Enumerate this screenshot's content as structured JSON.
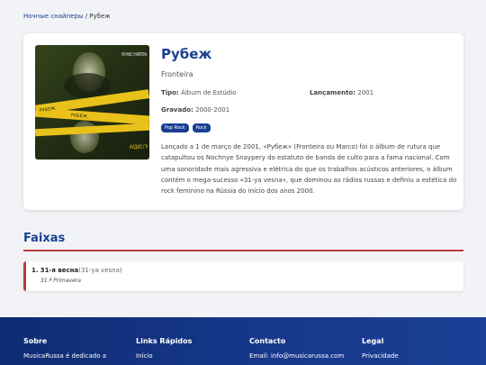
{
  "breadcrumb": {
    "link": "Ночные снайперы",
    "separator": "/",
    "current": "Рубеж"
  },
  "album": {
    "title": "Рубеж",
    "subtitle": "Fronteira",
    "type_label": "Tipo:",
    "type_value": "Álbum de Estúdio",
    "release_label": "Lançamento:",
    "release_value": "2001",
    "recorded_label": "Gravado:",
    "recorded_value": "2000-2001",
    "tags": [
      "Pop Rock",
      "Rock"
    ],
    "description": "Lançado a 1 de março de 2001, «Рубеж» (Fronteira ou Marco) foi o álbum de rutura que catapultou os Nochnye Snaypery do estatuto de banda de culto para a fama nacional. Com uma sonoridade mais agressiva e elétrica do que os trabalhos acústicos anteriores, o álbum contém o mega-sucesso «31-ya vesna», que dominou as rádios russas e definiu a estética do rock feminino na Rússia do início dos anos 2000."
  },
  "cover": {
    "band_text": "НОЧНЫЕ СНАЙПЕРЫ",
    "tape_text": "РУБЕЖ",
    "corner_text": "АУДИО ГР"
  },
  "tracks_section": {
    "title": "Faixas"
  },
  "tracks": [
    {
      "number": "1.",
      "title": "31-я весна",
      "alt": "(31-ya vesna)",
      "translation": "31.ª Primavera"
    }
  ],
  "footer": {
    "col1": {
      "heading": "Sobre",
      "text": "MusicaRussa é dedicado a"
    },
    "col2": {
      "heading": "Links Rápidos",
      "text": "Início"
    },
    "col3": {
      "heading": "Contacto",
      "text": "Email: info@musicarussa.com"
    },
    "col4": {
      "heading": "Legal",
      "text": "Privacidade"
    }
  },
  "colors": {
    "accent": "#1a3f94",
    "red": "#c0393b",
    "footer_bg": "#0e2b73"
  }
}
